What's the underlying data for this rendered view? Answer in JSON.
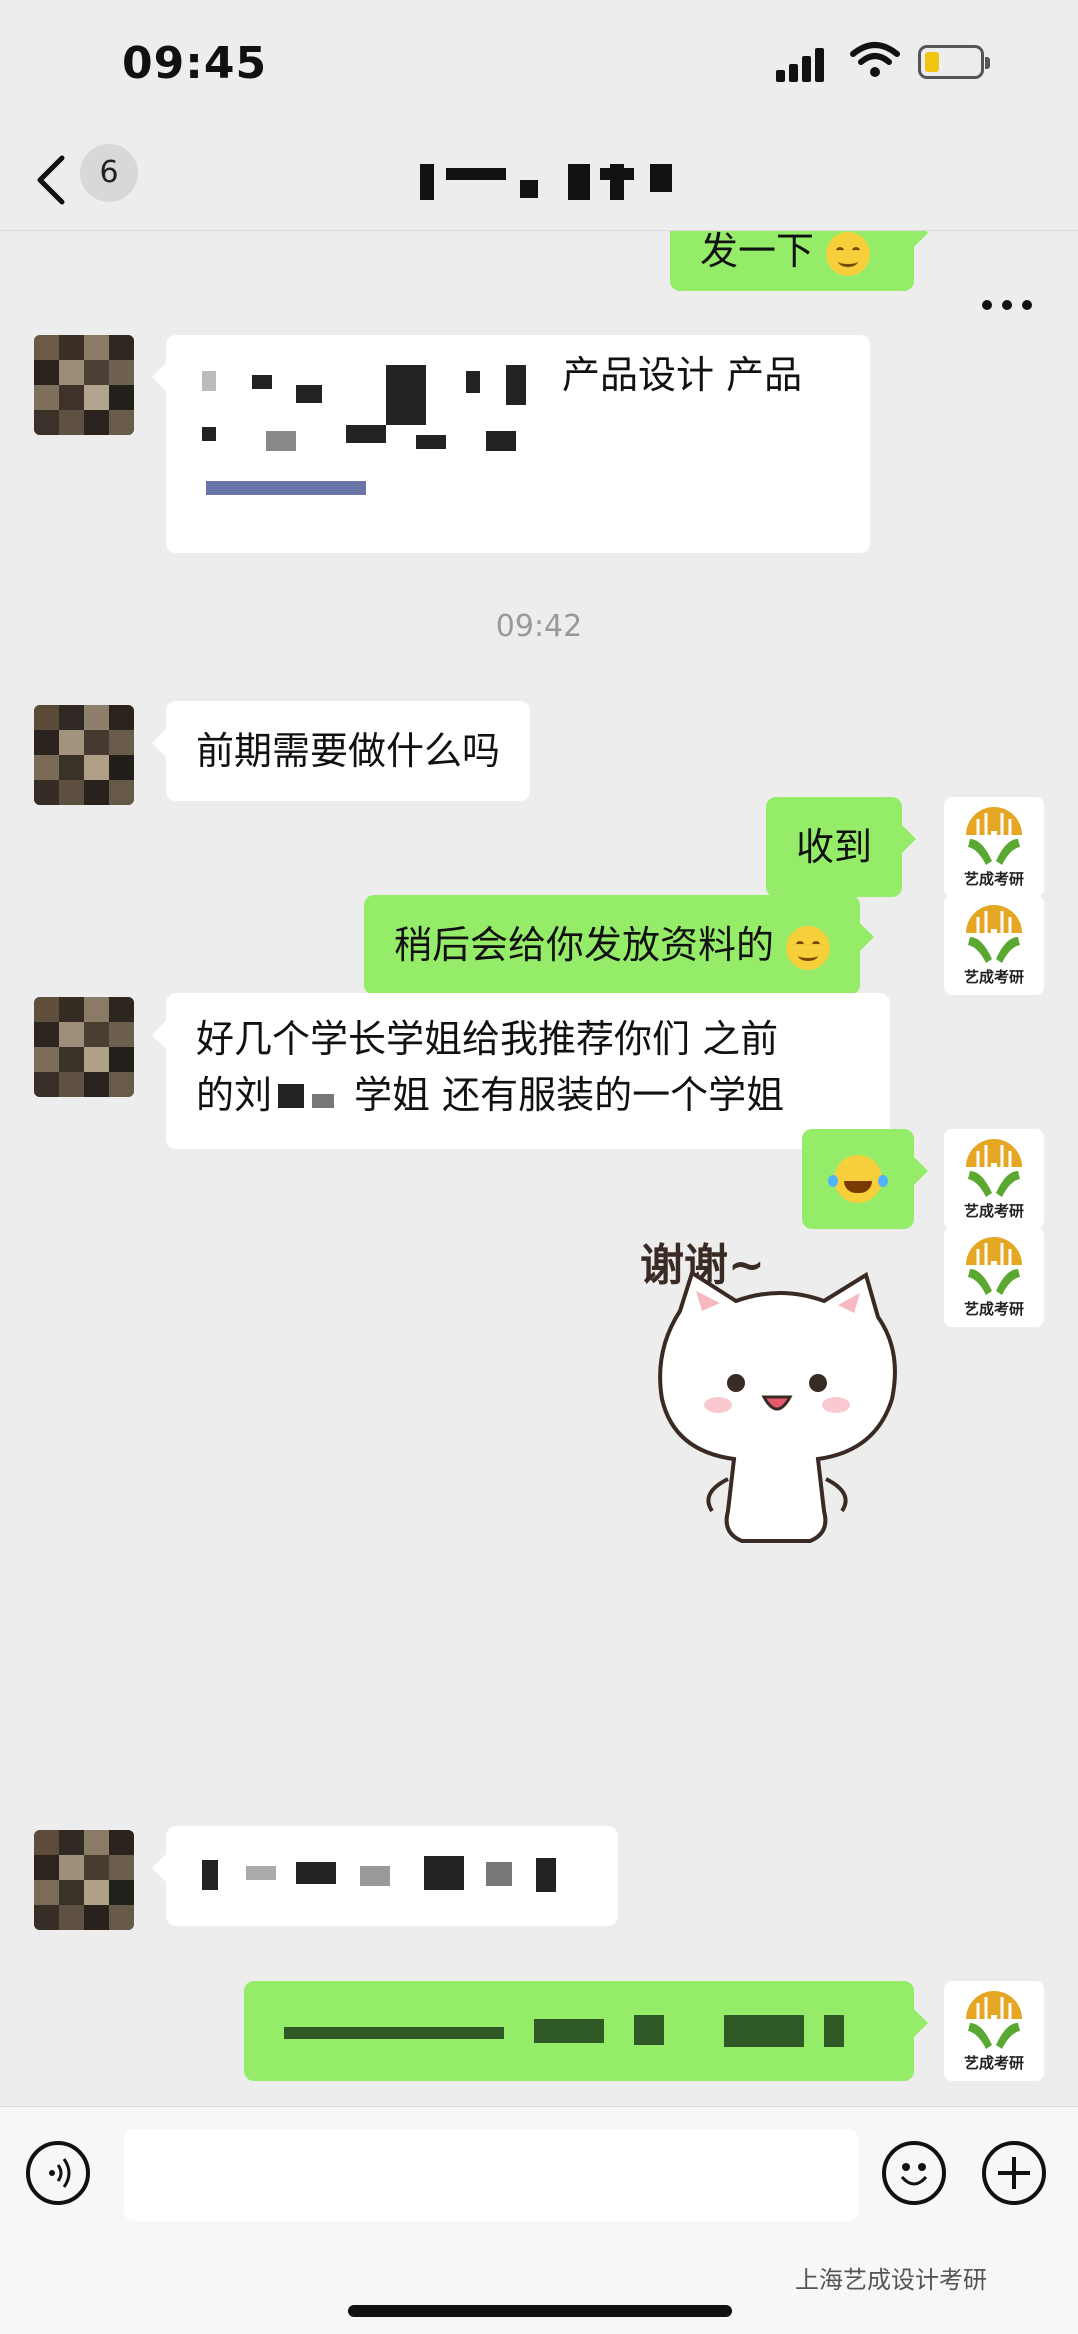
{
  "status_bar": {
    "time": "09:45"
  },
  "nav": {
    "back_count": "6"
  },
  "messages": {
    "top_partial": "发一下",
    "msg1_visible_text": "产品设计 产品",
    "timestamp": "09:42",
    "msg2": "前期需要做什么吗",
    "reply1": "收到",
    "reply2": "稍后会给你发放资料的",
    "msg3_line1": "好几个学长学姐给我推荐你们 之前",
    "msg3_line2a": "的刘",
    "msg3_line2b": "学姐 还有服装的一个学姐",
    "sticker_caption": "谢谢~"
  },
  "brand_avatar": {
    "label": "艺成考研"
  },
  "watermark": "上海艺成设计考研",
  "colors": {
    "bubble_self": "#95ec69",
    "bubble_other": "#ffffff",
    "background": "#ededed"
  },
  "icons": [
    "back-icon",
    "more-icon",
    "voice-icon",
    "emoji-icon",
    "plus-icon",
    "smile-emoji",
    "laughing-emoji"
  ]
}
